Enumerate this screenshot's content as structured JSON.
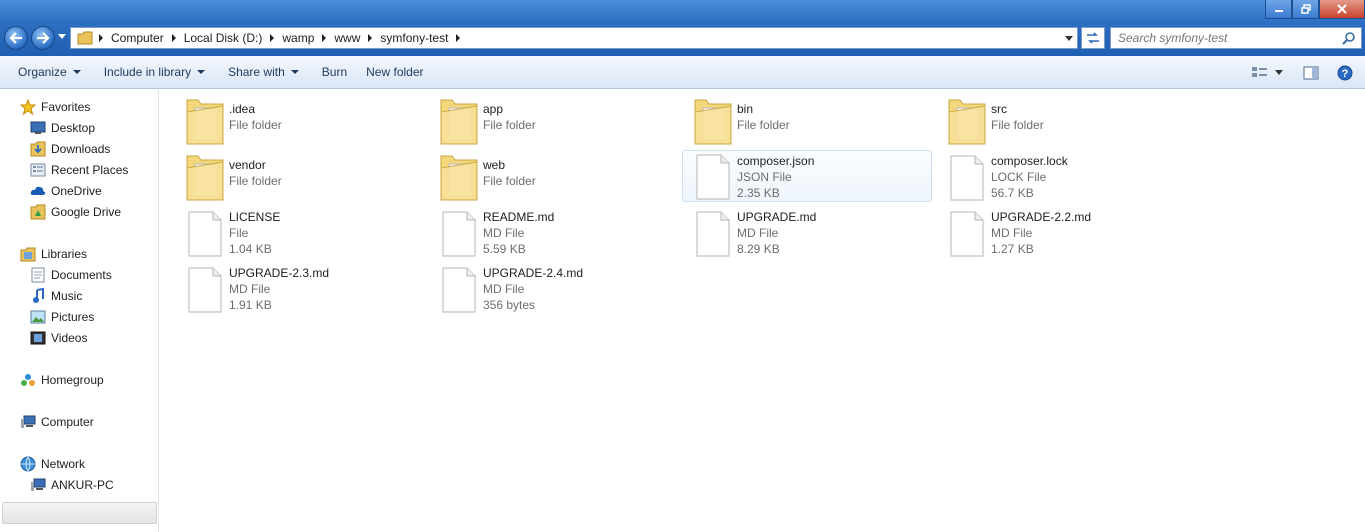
{
  "window": {
    "minimize_icon": "minimize-icon",
    "maximize_icon": "restore-icon",
    "close_icon": "close-icon"
  },
  "address": {
    "crumbs": [
      "Computer",
      "Local Disk (D:)",
      "wamp",
      "www",
      "symfony-test"
    ]
  },
  "search": {
    "placeholder": "Search symfony-test"
  },
  "toolbar": {
    "organize": "Organize",
    "include_in_library": "Include in library",
    "share_with": "Share with",
    "burn": "Burn",
    "new_folder": "New folder"
  },
  "nav": {
    "favorites": {
      "label": "Favorites",
      "items": [
        "Desktop",
        "Downloads",
        "Recent Places",
        "OneDrive",
        "Google Drive"
      ]
    },
    "libraries": {
      "label": "Libraries",
      "items": [
        "Documents",
        "Music",
        "Pictures",
        "Videos"
      ]
    },
    "homegroup": "Homegroup",
    "computer": "Computer",
    "network": {
      "label": "Network",
      "items": [
        "ANKUR-PC"
      ]
    }
  },
  "files": [
    {
      "name": ".idea",
      "type": "File folder",
      "size": "",
      "kind": "folder"
    },
    {
      "name": "app",
      "type": "File folder",
      "size": "",
      "kind": "folder"
    },
    {
      "name": "bin",
      "type": "File folder",
      "size": "",
      "kind": "folder"
    },
    {
      "name": "src",
      "type": "File folder",
      "size": "",
      "kind": "folder"
    },
    {
      "name": "vendor",
      "type": "File folder",
      "size": "",
      "kind": "folder"
    },
    {
      "name": "web",
      "type": "File folder",
      "size": "",
      "kind": "folder"
    },
    {
      "name": "composer.json",
      "type": "JSON File",
      "size": "2.35 KB",
      "kind": "file",
      "selected": true
    },
    {
      "name": "composer.lock",
      "type": "LOCK File",
      "size": "56.7 KB",
      "kind": "file"
    },
    {
      "name": "LICENSE",
      "type": "File",
      "size": "1.04 KB",
      "kind": "file"
    },
    {
      "name": "README.md",
      "type": "MD File",
      "size": "5.59 KB",
      "kind": "file"
    },
    {
      "name": "UPGRADE.md",
      "type": "MD File",
      "size": "8.29 KB",
      "kind": "file"
    },
    {
      "name": "UPGRADE-2.2.md",
      "type": "MD File",
      "size": "1.27 KB",
      "kind": "file"
    },
    {
      "name": "UPGRADE-2.3.md",
      "type": "MD File",
      "size": "1.91 KB",
      "kind": "file"
    },
    {
      "name": "UPGRADE-2.4.md",
      "type": "MD File",
      "size": "356 bytes",
      "kind": "file"
    }
  ]
}
